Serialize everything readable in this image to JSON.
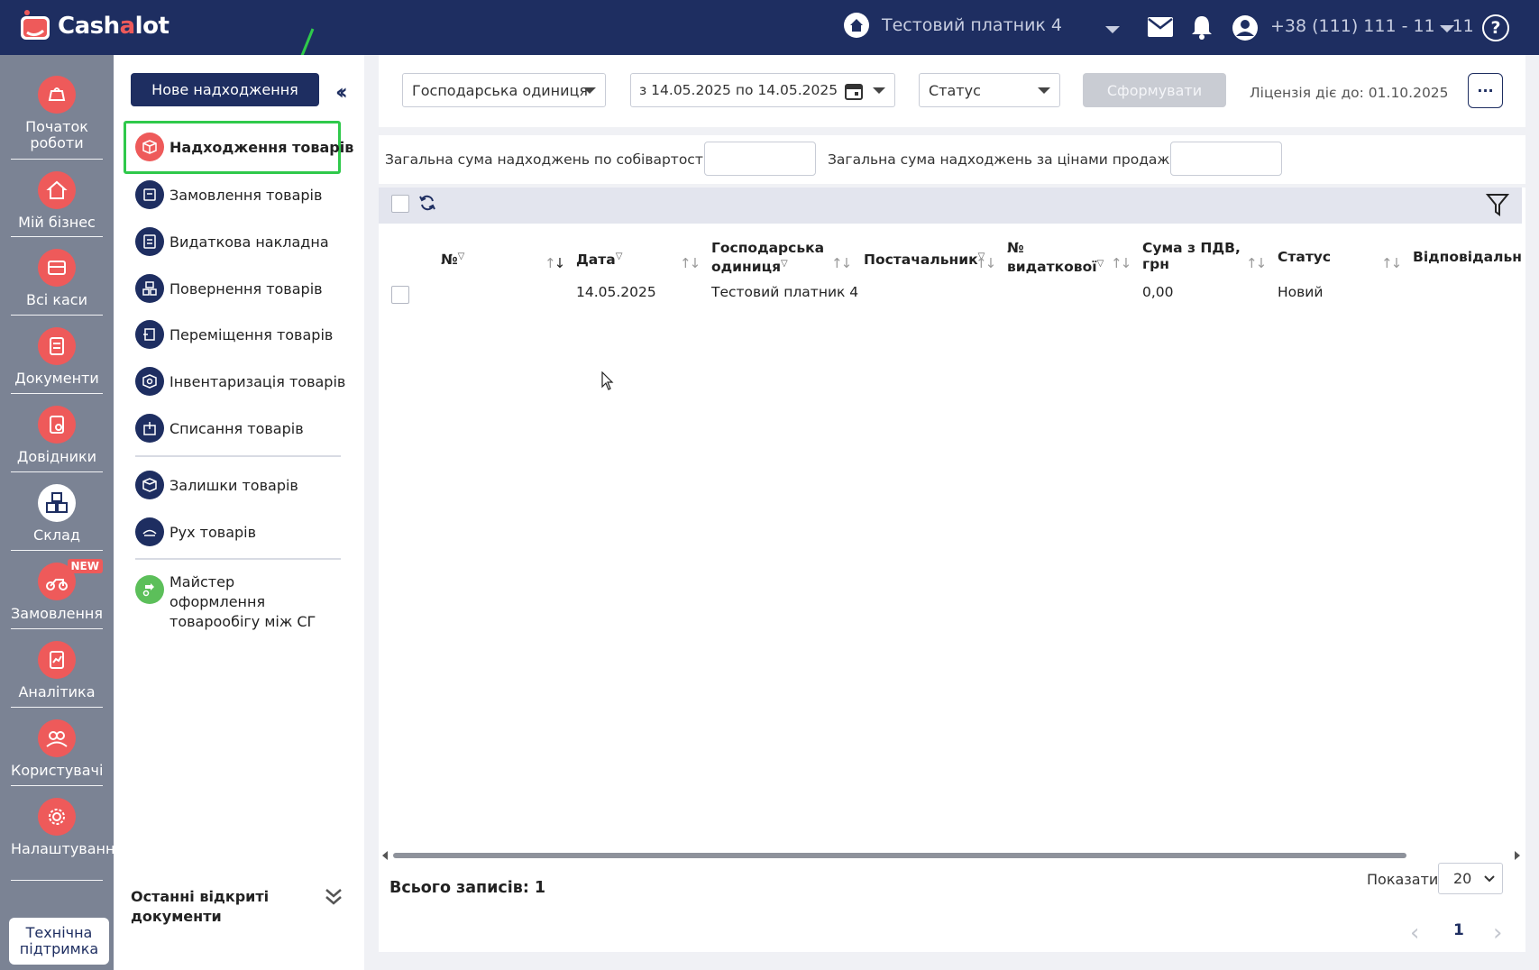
{
  "topbar": {
    "brand": "Cashalot",
    "brand_pre": "Cash",
    "brand_dot": "a",
    "brand_post": "lot",
    "company": "Тестовий платник 4",
    "phone": "+38 (111) 111 - 11 - 11",
    "help": "?"
  },
  "rail": {
    "items": [
      {
        "label": "Початок роботи",
        "icon": "bell-cart-icon"
      },
      {
        "label": "Мій бізнес",
        "icon": "home-icon"
      },
      {
        "label": "Всі каси",
        "icon": "cash-register-icon"
      },
      {
        "label": "Документи",
        "icon": "documents-icon"
      },
      {
        "label": "Довідники",
        "icon": "reference-book-icon"
      },
      {
        "label": "Склад",
        "icon": "warehouse-boxes-icon"
      },
      {
        "label": "Замовлення",
        "icon": "scooter-icon",
        "badge": "NEW"
      },
      {
        "label": "Аналітика",
        "icon": "analytics-icon"
      },
      {
        "label": "Користувачі",
        "icon": "users-icon"
      },
      {
        "label": "Налаштування",
        "icon": "settings-gear-icon"
      }
    ],
    "support": "Технічна підтримка"
  },
  "sidebar": {
    "new_button": "Нове надходження",
    "items": [
      {
        "label": "Надходження товарів",
        "active": true
      },
      {
        "label": "Замовлення товарів"
      },
      {
        "label": "Видаткова накладна"
      },
      {
        "label": "Повернення товарів"
      },
      {
        "label": "Переміщення товарів"
      },
      {
        "label": "Інвентаризація товарів"
      },
      {
        "label": "Списання товарів"
      },
      {
        "label": "Залишки товарів"
      },
      {
        "label": "Рух товарів"
      },
      {
        "label": "Майстер оформлення товарообігу між СГ"
      }
    ],
    "recent": "Останні відкриті документи"
  },
  "filters": {
    "unit": "Господарська одиниця",
    "date_range": "з 14.05.2025 по 14.05.2025",
    "status": "Статус",
    "generate": "Сформувати",
    "license": "Ліцензія діє до: 01.10.2025",
    "more": "···"
  },
  "summary": {
    "cost_label": "Загальна сума надходжень по собівартості, грн",
    "sale_label": "Загальна сума надходжень за цінами продажу, грн",
    "cost_value": "",
    "sale_value": ""
  },
  "table": {
    "columns": [
      "№",
      "Дата",
      "Господарська одиниця",
      "Постачальник",
      "№ видаткової",
      "Сума з ПДВ, грн",
      "Статус",
      "Відповідальний"
    ],
    "rows": [
      {
        "number": "",
        "date": "14.05.2025",
        "unit": "Тестовий платник 4",
        "supplier": "",
        "invoice": "",
        "sum": "0,00",
        "status": "Новий",
        "responsible": ""
      }
    ]
  },
  "footer": {
    "total": "Всього записів: 1",
    "show_label": "Показати",
    "page_size": "20",
    "page": "1"
  },
  "colors": {
    "navy": "#1e2e61",
    "accent_red": "#ee5a5a",
    "active_outline": "#2fc94b",
    "rail_bg": "#7b8394"
  }
}
